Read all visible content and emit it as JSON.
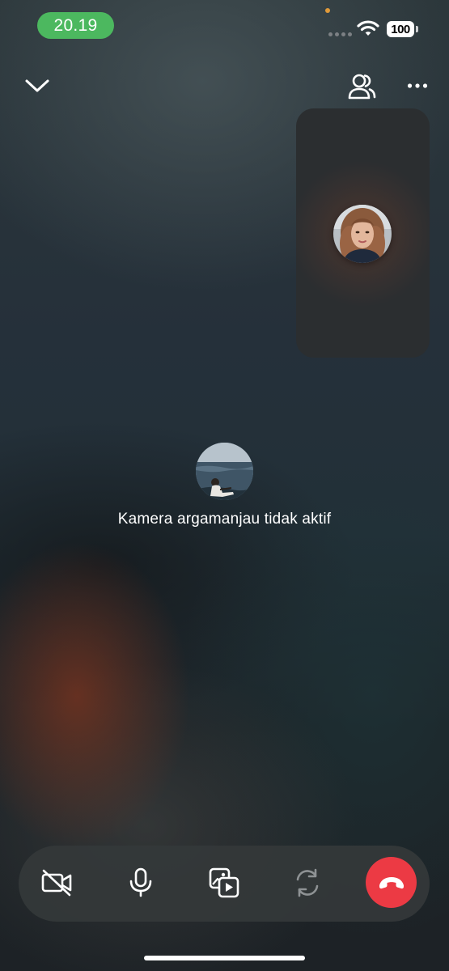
{
  "status_bar": {
    "time": "20.19",
    "battery": "100",
    "colors": {
      "time_pill": "#4cb85f",
      "privacy_dot": "#e09a3a"
    }
  },
  "top_bar": {
    "collapse_icon": "chevron-down-icon",
    "participants_icon": "participants-icon",
    "more_icon": "more-dots-icon"
  },
  "self_preview": {
    "avatar_icon": "self-avatar-photo"
  },
  "remote": {
    "avatar_icon": "remote-avatar-photo",
    "camera_off_text": "Kamera argamanjau tidak aktif"
  },
  "controls": {
    "items": [
      {
        "name": "camera-off-button",
        "icon": "video-off-icon"
      },
      {
        "name": "mic-button",
        "icon": "microphone-icon"
      },
      {
        "name": "share-media-button",
        "icon": "media-share-icon"
      },
      {
        "name": "flip-camera-button",
        "icon": "camera-flip-icon",
        "state": "disabled"
      },
      {
        "name": "end-call-button",
        "icon": "phone-hangup-icon",
        "color": "#ec3a44"
      }
    ]
  }
}
